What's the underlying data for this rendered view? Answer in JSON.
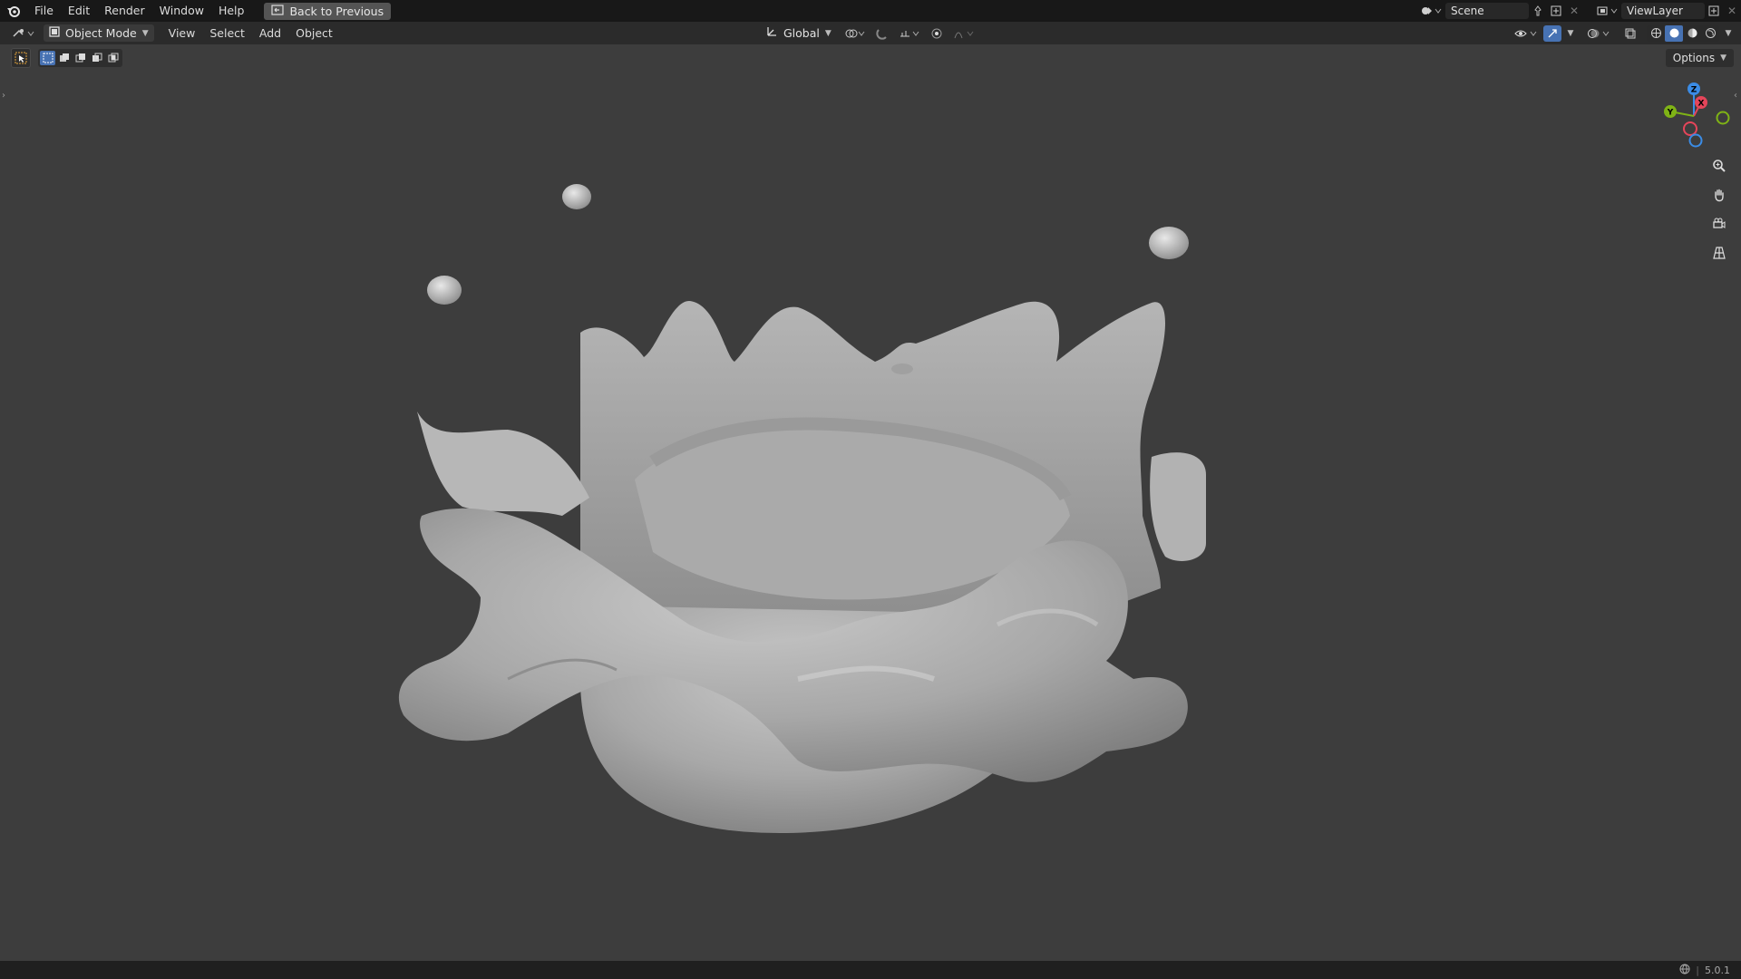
{
  "topbar": {
    "menu": [
      "File",
      "Edit",
      "Render",
      "Window",
      "Help"
    ],
    "back_button": "Back to Previous",
    "scene_name": "Scene",
    "view_layer": "ViewLayer"
  },
  "header": {
    "mode": "Object Mode",
    "menus": [
      "View",
      "Select",
      "Add",
      "Object"
    ],
    "orientation": "Global",
    "options": "Options"
  },
  "viewport": {
    "gizmo_axes": [
      "Z",
      "X",
      "Y"
    ]
  },
  "status": {
    "version": "5.0.1"
  },
  "colors": {
    "accent": "#4772b3",
    "axis_x": "#e5455a",
    "axis_y": "#7fb316",
    "axis_z": "#3b8ce6"
  }
}
